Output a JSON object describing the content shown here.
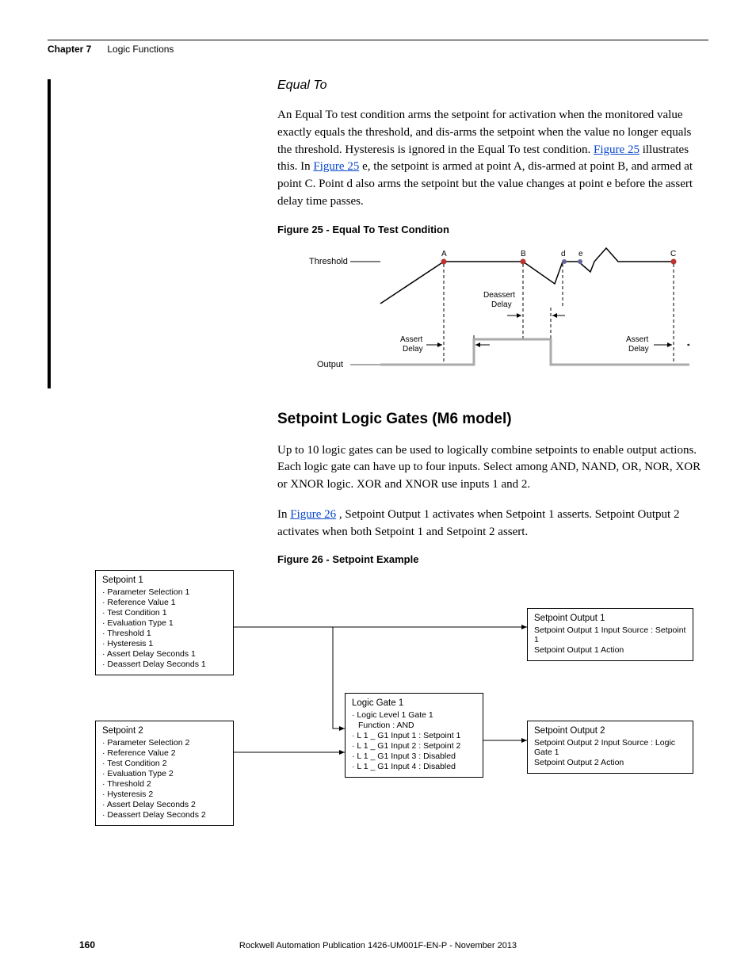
{
  "header": {
    "chapter_label": "Chapter 7",
    "chapter_title": "Logic Functions"
  },
  "section_equal_to": {
    "title": "Equal To",
    "para": "An Equal To test condition arms the setpoint for activation when the monitored value exactly equals the threshold, and dis-arms the setpoint when the value no longer equals the threshold. Hysteresis is ignored in the Equal To test condition. ",
    "link1": "Figure 25",
    "para_mid1": " illustrates this. In ",
    "link2": "Figure 25",
    "para_mid2": "e, the setpoint is armed at point A, dis-armed at point B, and armed at point C. Point d also arms the setpoint but the value changes at point e before the assert delay time passes."
  },
  "figure25": {
    "caption": "Figure 25 - Equal To Test Condition",
    "labels": {
      "threshold": "Threshold",
      "output": "Output",
      "assert_delay": "Assert\nDelay",
      "deassert_delay": "Deassert\nDelay",
      "A": "A",
      "B": "B",
      "C": "C",
      "d": "d",
      "e": "e"
    }
  },
  "section_gates": {
    "title": "Setpoint Logic Gates (M6 model)",
    "para1": "Up to 10 logic gates can be used to logically combine setpoints to enable output actions. Each logic gate can have up to four inputs. Select among AND, NAND, OR, NOR, XOR or XNOR logic. XOR and XNOR use inputs 1 and 2.",
    "para2_pre": "In ",
    "para2_link": "Figure 26",
    "para2_post": ", Setpoint Output 1 activates when Setpoint 1 asserts. Setpoint Output 2 activates when both Setpoint 1 and Setpoint 2 assert."
  },
  "figure26": {
    "caption": "Figure 26 - Setpoint Example",
    "setpoint1": {
      "title": "Setpoint 1",
      "items": [
        "Parameter Selection  1",
        "Reference Value  1",
        "Test Condition  1",
        "Evaluation Type  1",
        "Threshold   1",
        "Hysteresis  1",
        "Assert Delay Seconds  1",
        "Deassert Delay Seconds  1"
      ]
    },
    "setpoint2": {
      "title": "Setpoint 2",
      "items": [
        "Parameter Selection  2",
        "Reference Value  2",
        "Test Condition  2",
        "Evaluation Type  2",
        "Threshold   2",
        "Hysteresis  2",
        "Assert Delay Seconds  2",
        "Deassert Delay Seconds  2"
      ]
    },
    "gate": {
      "title": "Logic Gate  1",
      "items": [
        "Logic Level  1   Gate  1",
        "Function : AND",
        "L 1 _ G1   Input 1 :  Setpoint  1",
        "L 1 _ G1   Input 2 :  Setpoint  2",
        "L 1 _ G1   Input 3 :  Disabled",
        "L 1 _ G1   Input 4 :  Disabled"
      ]
    },
    "out1": {
      "title": "Setpoint Output  1",
      "items": [
        "Setpoint Output 1  Input Source :  Setpoint  1",
        "Setpoint Output 1  Action"
      ]
    },
    "out2": {
      "title": "Setpoint Output  2",
      "items": [
        "Setpoint Output 2  Input Source :  Logic Gate         1",
        "Setpoint Output 2  Action"
      ]
    }
  },
  "footer": {
    "page": "160",
    "pub": "Rockwell Automation Publication 1426-UM001F-EN-P - November 2013"
  }
}
